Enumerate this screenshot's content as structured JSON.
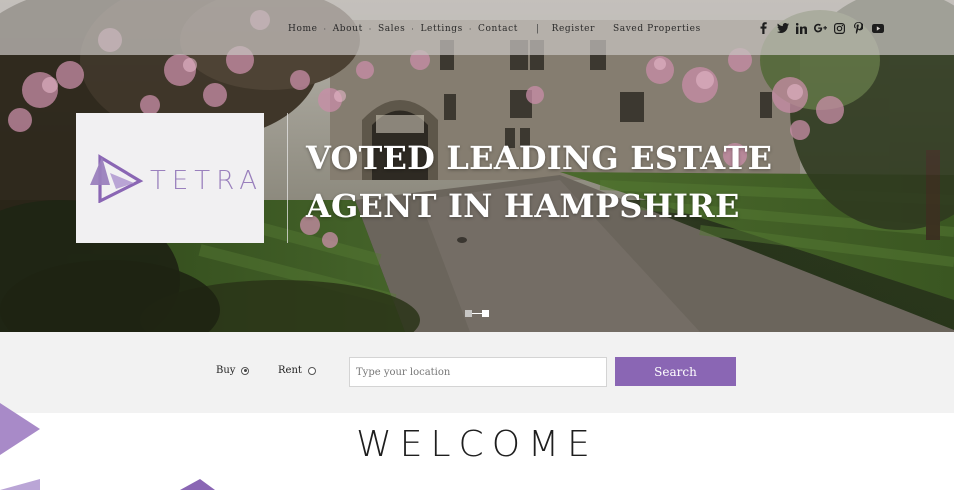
{
  "nav": {
    "items": [
      "Home",
      "About",
      "Sales",
      "Lettings",
      "Contact"
    ],
    "separator": "·",
    "divider": "|",
    "account_items": [
      "Register",
      "Saved Properties"
    ]
  },
  "social": {
    "icons": [
      "facebook-icon",
      "twitter-icon",
      "linkedin-icon",
      "google-plus-icon",
      "instagram-icon",
      "pinterest-icon",
      "youtube-icon"
    ]
  },
  "brand": {
    "name": "TETRA",
    "accent_color": "#8a66b4"
  },
  "hero": {
    "headline_line1": "VOTED LEADING ESTATE",
    "headline_line2": "AGENT IN HAMPSHIRE",
    "slides_total": 2,
    "active_slide": 2
  },
  "search": {
    "options": [
      {
        "label": "Buy",
        "selected": true
      },
      {
        "label": "Rent",
        "selected": false
      }
    ],
    "placeholder": "Type your location",
    "button_label": "Search"
  },
  "welcome": {
    "title": "WELCOME"
  }
}
